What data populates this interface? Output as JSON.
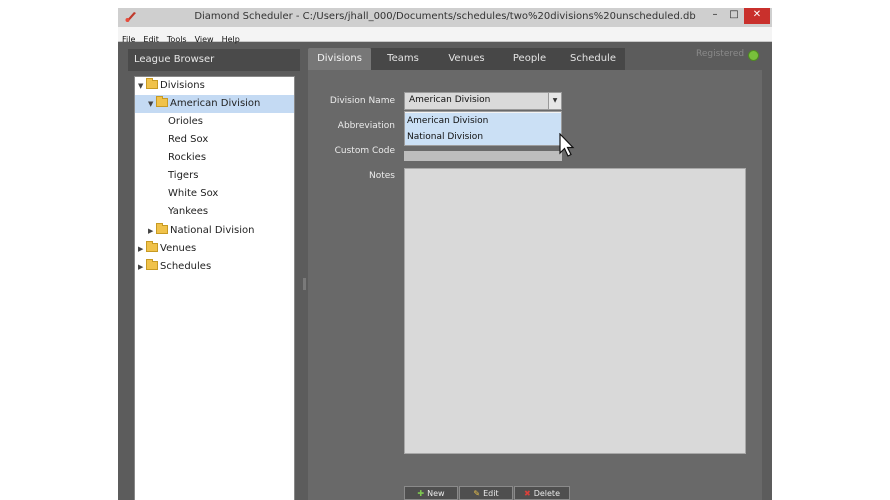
{
  "window": {
    "title": "Diamond Scheduler - C:/Users/jhall_000/Documents/schedules/two%20divisions%20unscheduled.db",
    "min_label": "–",
    "max_label": "□",
    "close_label": "✕"
  },
  "menu": [
    "File",
    "Edit",
    "Tools",
    "View",
    "Help"
  ],
  "left_panel": {
    "header": "League Browser",
    "tree": {
      "divisions": "Divisions",
      "american": "American Division",
      "teams": [
        "Orioles",
        "Red Sox",
        "Rockies",
        "Tigers",
        "White Sox",
        "Yankees"
      ],
      "national": "National Division",
      "venues": "Venues",
      "schedules": "Schedules"
    }
  },
  "tabs": [
    "Divisions",
    "Teams",
    "Venues",
    "People",
    "Schedule"
  ],
  "active_tab": "Divisions",
  "status": {
    "registered": "Registered",
    "color": "#78c03b"
  },
  "form": {
    "division_name_label": "Division Name",
    "abbreviation_label": "Abbreviation",
    "custom_code_label": "Custom Code",
    "notes_label": "Notes",
    "division_name_value": "American Division",
    "options": [
      "American Division",
      "National Division"
    ]
  },
  "buttons": {
    "new": "New",
    "edit": "Edit",
    "delete": "Delete"
  },
  "colors": {
    "accent_selection": "#c4daf3",
    "close_button": "#c9302c"
  }
}
